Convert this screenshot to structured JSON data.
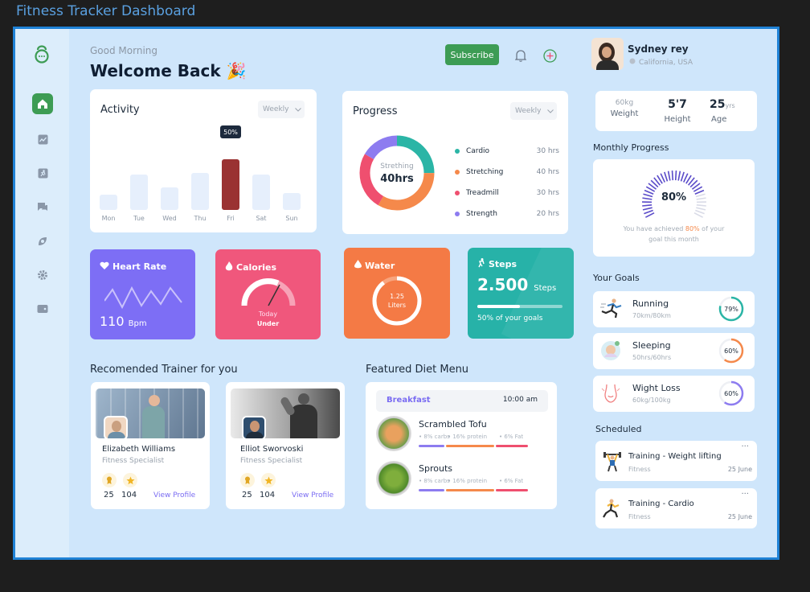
{
  "window_title": "Fitness Tracker Dashboard",
  "header": {
    "greeting": "Good Morning",
    "title": "Welcome Back",
    "emoji": "🎉",
    "subscribe_label": "Subscribe"
  },
  "activity": {
    "title": "Activity",
    "period": "Weekly",
    "tooltip": "50%",
    "chart_data": {
      "type": "bar",
      "categories": [
        "Mon",
        "Tue",
        "Wed",
        "Thu",
        "Fri",
        "Sat",
        "Sun"
      ],
      "values": [
        22,
        50,
        32,
        52,
        72,
        50,
        24
      ],
      "highlight": "Fri",
      "ylim": [
        0,
        100
      ]
    }
  },
  "progress": {
    "title": "Progress",
    "period": "Weekly",
    "center_label": "Strething",
    "center_value": "40hrs",
    "chart_data": {
      "type": "pie",
      "labels": [
        "Cardio",
        "Stretching",
        "Treadmill",
        "Strength"
      ],
      "values": [
        30,
        40,
        30,
        20
      ],
      "display": [
        "30 hrs",
        "40 hrs",
        "30 hrs",
        "20 hrs"
      ],
      "colors": [
        "#2bb5a6",
        "#f5894b",
        "#ef4f6f",
        "#8d7cf0"
      ]
    }
  },
  "heart_rate": {
    "title": "Heart Rate",
    "value": "110",
    "unit": "Bpm"
  },
  "calories": {
    "title": "Calories",
    "sub1": "Today",
    "sub2": "Under",
    "gauge_level": 0.7
  },
  "water": {
    "title": "Water",
    "value": "1.25",
    "unit": "Liters",
    "level": 0.9
  },
  "steps": {
    "title": "Steps",
    "value": "2.500",
    "unit": "Steps",
    "caption": "50% of your goals",
    "progress": 0.5
  },
  "trainers": {
    "title": "Recomended Trainer for you",
    "items": [
      {
        "name": "Elizabeth Williams",
        "role": "Fitness Specialist",
        "stat1": "25",
        "stat2": "104",
        "link": "View Profile"
      },
      {
        "name": "Elliot  Sworvoski",
        "role": "Fitness Specialist",
        "stat1": "25",
        "stat2": "104",
        "link": "View Profile"
      }
    ]
  },
  "diet": {
    "title": "Featured Diet Menu",
    "meal": "Breakfast",
    "time": "10:00 am",
    "items": [
      {
        "name": "Scrambled Tofu",
        "carbs": "• 8% carbs",
        "protein": "• 16% protein",
        "fat": "• 6% Fat"
      },
      {
        "name": "Sprouts",
        "carbs": "• 8% carbs",
        "protein": "• 16% protein",
        "fat": "• 6% Fat"
      }
    ]
  },
  "profile": {
    "name": "Sydney rey",
    "location": "California, USA",
    "weight": "60kg",
    "weight_label": "Weight",
    "height": "5'7",
    "height_label": "Height",
    "age": "25",
    "age_unit": "yrs",
    "age_label": "Age"
  },
  "monthly": {
    "title": "Monthly Progress",
    "value": "80%",
    "level": 0.8,
    "text1": "You have achieved ",
    "highlight": "80%",
    "text2": " of your",
    "text3": "goal this month"
  },
  "goals": {
    "title": "Your Goals",
    "items": [
      {
        "name": "Running",
        "detail": "70km/80km",
        "percent": "79%",
        "level": 0.79,
        "color": "#2bb5a6"
      },
      {
        "name": "Sleeping",
        "detail": "50hrs/60hrs",
        "percent": "60%",
        "level": 0.6,
        "color": "#f5894b"
      },
      {
        "name": "Wight Loss",
        "detail": "60kg/100kg",
        "percent": "60%",
        "level": 0.6,
        "color": "#8d7cf0"
      }
    ]
  },
  "scheduled": {
    "title": "Scheduled",
    "items": [
      {
        "name": "Training - Weight lifting",
        "type": "Fitness",
        "date": "25 June"
      },
      {
        "name": "Training -  Cardio",
        "type": "Fitness",
        "date": "25 June"
      }
    ]
  },
  "colors": {
    "accent": "#3d9c54",
    "frame": "#cfe6fb",
    "heart": "#7d6ef5",
    "calories": "#f0577c",
    "water": "#f47a45",
    "steps": "#27b2a8"
  }
}
